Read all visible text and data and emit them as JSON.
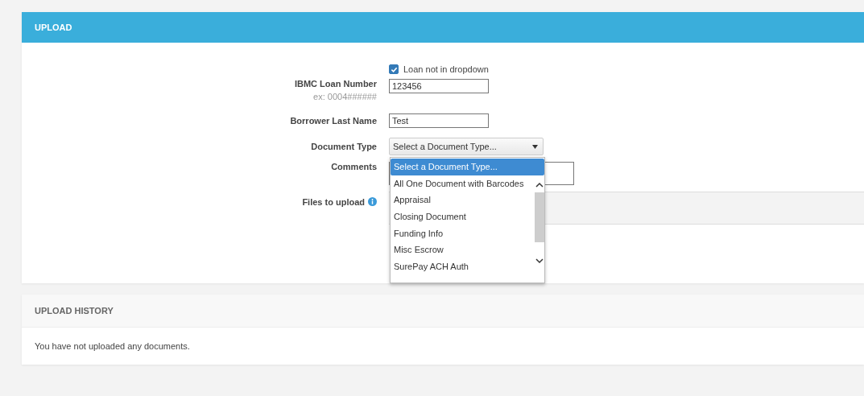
{
  "upload": {
    "title": "UPLOAD",
    "loan_not_in_dropdown": {
      "label": "Loan not in dropdown",
      "checked": true
    },
    "loan_number": {
      "label": "IBMC Loan Number",
      "value": "123456",
      "hint": "ex: 0004######"
    },
    "borrower_last_name": {
      "label": "Borrower Last Name",
      "value": "Test"
    },
    "document_type": {
      "label": "Document Type",
      "value": "Select a Document Type...",
      "expanded": true,
      "options": [
        {
          "label": "Select a Document Type...",
          "selected": true
        },
        {
          "label": "All One Document with Barcodes",
          "selected": false
        },
        {
          "label": "Appraisal",
          "selected": false
        },
        {
          "label": "Closing Document",
          "selected": false
        },
        {
          "label": "Funding Info",
          "selected": false
        },
        {
          "label": "Misc Escrow",
          "selected": false
        },
        {
          "label": "SurePay ACH Auth",
          "selected": false
        }
      ]
    },
    "comments": {
      "label": "Comments"
    },
    "files": {
      "label": "Files to upload"
    }
  },
  "upload_history": {
    "title": "UPLOAD HISTORY",
    "message": "You have not uploaded any documents."
  }
}
